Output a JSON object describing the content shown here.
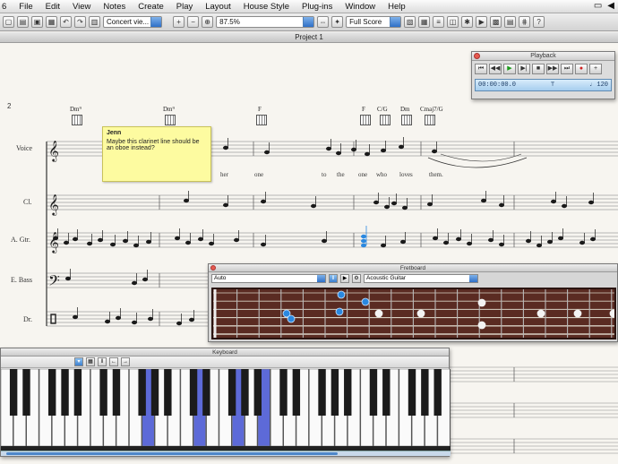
{
  "menubar": {
    "items": [
      "6",
      "File",
      "Edit",
      "View",
      "Notes",
      "Create",
      "Play",
      "Layout",
      "House Style",
      "Plug-ins",
      "Window",
      "Help"
    ]
  },
  "toolbar": {
    "view_select": "Concert vie...",
    "zoom_select": "87.5%",
    "view_mode_select": "Full Score"
  },
  "document": {
    "title": "Project 1"
  },
  "score": {
    "system_number": "2",
    "instruments": [
      "Voice",
      "Cl.",
      "A. Gtr.",
      "E. Bass",
      "Dr."
    ],
    "chords": [
      "Dm⁹",
      "Dm⁹",
      "F",
      "F",
      "C/G",
      "Dm",
      "Cmaj7/G"
    ],
    "lyrics": [
      "her",
      "one",
      "to",
      "the",
      "one",
      "who",
      "loves",
      "them."
    ]
  },
  "comment": {
    "author": "Jenn",
    "text": "Maybe this clarinet line should be an oboe instead?"
  },
  "playback": {
    "title": "Playback",
    "time": "00:00:00.0",
    "tempo": "♩ 120"
  },
  "fretboard": {
    "title": "Fretboard",
    "mode": "Auto",
    "instrument": "Acoustic Guitar"
  },
  "keyboard": {
    "title": "Keyboard"
  },
  "colors": {
    "selection": "#3c7fcf",
    "note_accent": "#2a88e0",
    "comment_bg": "#fdfba0"
  }
}
